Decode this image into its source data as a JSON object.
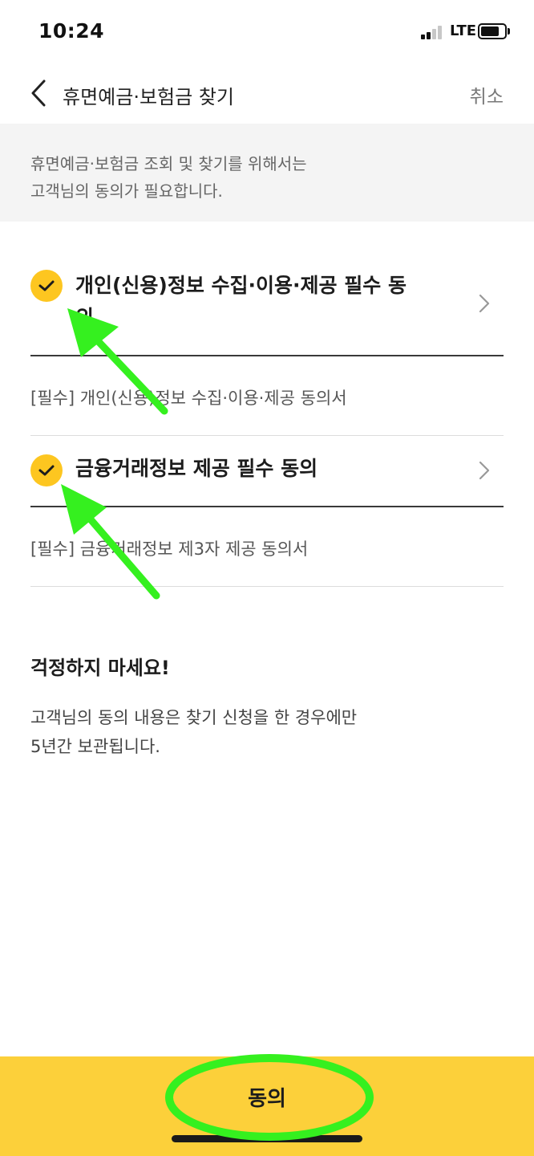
{
  "status_bar": {
    "time": "10:24",
    "network": "LTE",
    "icons": [
      "cellular-signal-icon",
      "battery-icon"
    ]
  },
  "nav": {
    "title": "휴면예금·보험금 찾기",
    "cancel_label": "취소",
    "back_icon": "chevron-left-icon"
  },
  "notice": {
    "line1": "휴면예금·보험금 조회 및 찾기를 위해서는",
    "line2": "고객님의 동의가 필요합니다."
  },
  "consents": [
    {
      "title_line1": "개인(신용)정보 수집·이용·제공 필수 동",
      "title_line2": "의",
      "checked": true,
      "sub_item": "[필수] 개인(신용)정보 수집·이용·제공 동의서"
    },
    {
      "title_line1": "금융거래정보 제공 필수 동의",
      "checked": true,
      "sub_item": "[필수] 금융거래정보 제3자 제공 동의서"
    }
  ],
  "reassurance": {
    "title": "걱정하지 마세요!",
    "line1": "고객님의 동의 내용은 찾기 신청을 한 경우에만",
    "line2": "5년간 보관됩니다."
  },
  "agree_button": {
    "label": "동의"
  },
  "colors": {
    "accent": "#fdc620",
    "button_bg": "#fcd03a",
    "annotation_green": "#35f01f"
  }
}
